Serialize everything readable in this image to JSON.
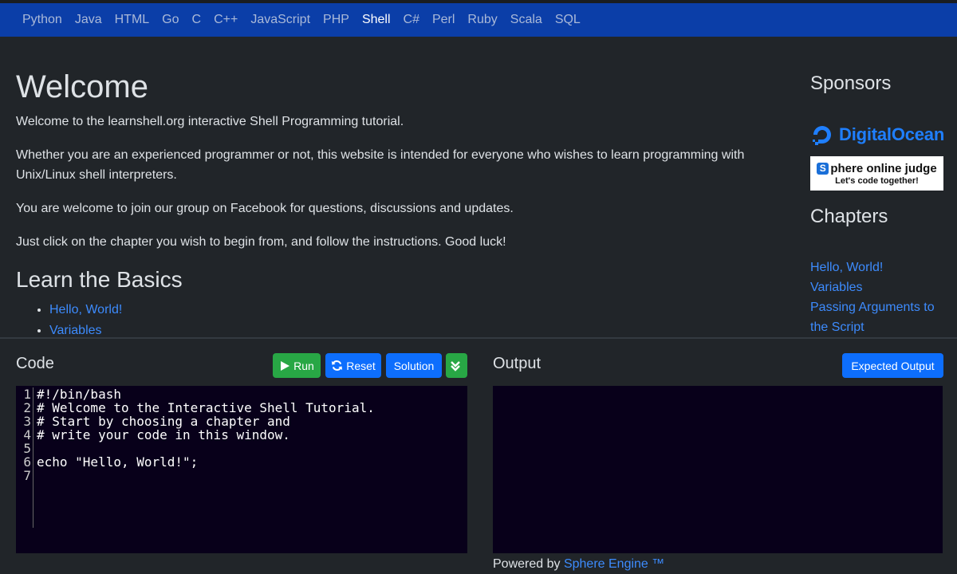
{
  "nav": {
    "items": [
      "Python",
      "Java",
      "HTML",
      "Go",
      "C",
      "C++",
      "JavaScript",
      "PHP",
      "Shell",
      "C#",
      "Perl",
      "Ruby",
      "Scala",
      "SQL"
    ],
    "active": "Shell"
  },
  "main": {
    "title": "Welcome",
    "p1": "Welcome to the learnshell.org interactive Shell Programming tutorial.",
    "p2": "Whether you are an experienced programmer or not, this website is intended for everyone who wishes to learn programming with Unix/Linux shell interpreters.",
    "p3": "You are welcome to join our group on Facebook for questions, discussions and updates.",
    "p4": "Just click on the chapter you wish to begin from, and follow the instructions. Good luck!",
    "basics_title": "Learn the Basics",
    "basics": [
      "Hello, World!",
      "Variables"
    ]
  },
  "sidebar": {
    "sponsors_title": "Sponsors",
    "do_name": "DigitalOcean",
    "soj_name": "phere online judge",
    "soj_letter": "S",
    "soj_tagline": "Let's code together!",
    "chapters_title": "Chapters",
    "chapters": [
      "Hello, World!",
      "Variables",
      "Passing Arguments to",
      "the Script"
    ]
  },
  "code_panel": {
    "title": "Code",
    "run": "Run",
    "reset": "Reset",
    "solution": "Solution",
    "lines": [
      "#!/bin/bash",
      "# Welcome to the Interactive Shell Tutorial.",
      "# Start by choosing a chapter and",
      "# write your code in this window.",
      "",
      "echo \"Hello, World!\";",
      ""
    ],
    "line_numbers": [
      "1",
      "2",
      "3",
      "4",
      "5",
      "6",
      "7"
    ]
  },
  "output_panel": {
    "title": "Output",
    "expected": "Expected Output",
    "powered_prefix": "Powered by",
    "powered_link": "Sphere Engine ™"
  },
  "colors": {
    "nav_bg": "#0b3ea8",
    "page_bg": "#212529",
    "link": "#3d8bfd",
    "editor_bg": "#08001a",
    "green": "#28a745",
    "blue": "#0d6efd"
  }
}
